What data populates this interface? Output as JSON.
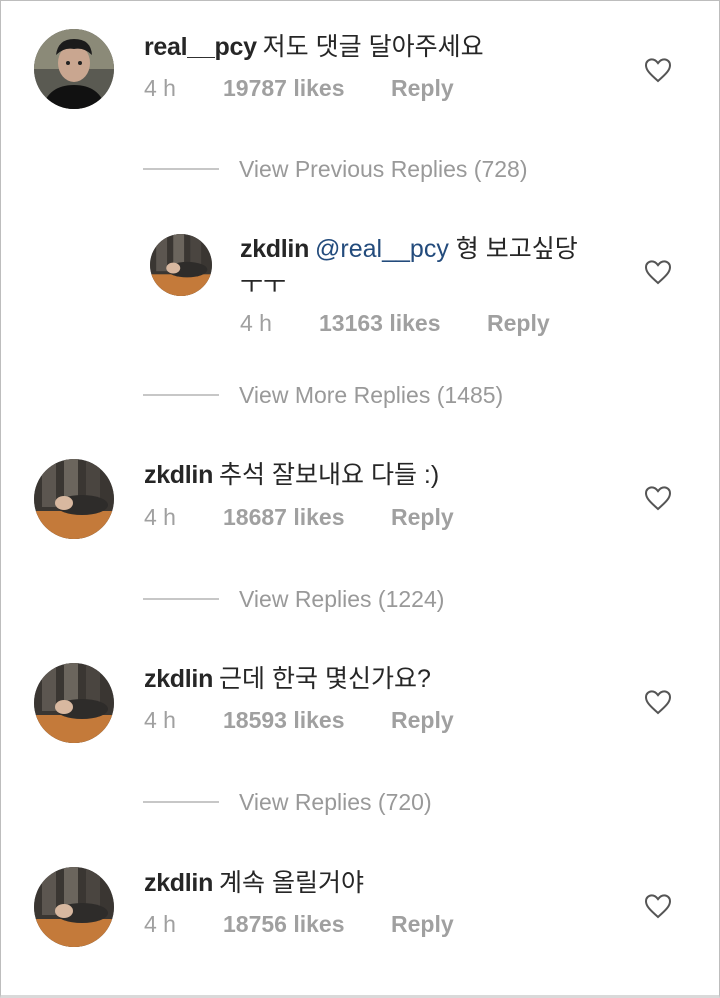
{
  "comments": [
    {
      "user": "real__pcy",
      "text": "저도 댓글 달아주세요",
      "time": "4 h",
      "likes": "19787 likes",
      "reply": "Reply",
      "avatar": "avatar-pcy"
    },
    {
      "user": "zkdlin",
      "mention": "@real__pcy",
      "text": "형 보고싶당",
      "text2": "ㅜㅜ",
      "time": "4 h",
      "likes": "13163 likes",
      "reply": "Reply",
      "avatar": "avatar-zkdlin"
    },
    {
      "user": "zkdlin",
      "text": "추석 잘보내요 다들 :)",
      "time": "4 h",
      "likes": "18687 likes",
      "reply": "Reply",
      "avatar": "avatar-zkdlin"
    },
    {
      "user": "zkdlin",
      "text": "근데 한국 몇신가요?",
      "time": "4 h",
      "likes": "18593 likes",
      "reply": "Reply",
      "avatar": "avatar-zkdlin"
    },
    {
      "user": "zkdlin",
      "text": "계속 올릴거야",
      "time": "4 h",
      "likes": "18756 likes",
      "reply": "Reply",
      "avatar": "avatar-zkdlin"
    }
  ],
  "reply_links": [
    "View Previous Replies (728)",
    "View More Replies (1485)",
    "View Replies (1224)",
    "View Replies (720)"
  ],
  "icons": {
    "like": "heart-outline-icon"
  },
  "colors": {
    "username": "#262626",
    "meta": "#a0a0a0",
    "mention": "#234b7c",
    "divider": "#c7c7c7"
  }
}
